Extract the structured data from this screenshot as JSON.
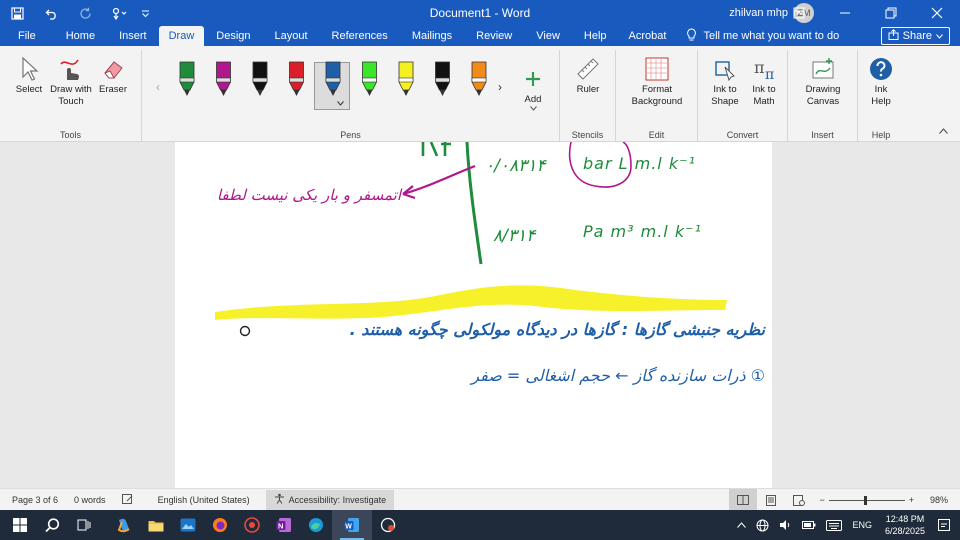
{
  "window": {
    "doc_title": "Document1 - Word",
    "user_name": "zhilvan mhp",
    "avatar_initials": "ZM"
  },
  "tabs": [
    {
      "label": "File"
    },
    {
      "label": "Home"
    },
    {
      "label": "Insert"
    },
    {
      "label": "Draw"
    },
    {
      "label": "Design"
    },
    {
      "label": "Layout"
    },
    {
      "label": "References"
    },
    {
      "label": "Mailings"
    },
    {
      "label": "Review"
    },
    {
      "label": "View"
    },
    {
      "label": "Help"
    },
    {
      "label": "Acrobat"
    }
  ],
  "active_tab": "Draw",
  "tell_me": "Tell me what you want to do",
  "share_label": "Share",
  "ribbon": {
    "tools": {
      "select": "Select",
      "draw_touch": "Draw with Touch",
      "eraser": "Eraser",
      "group": "Tools"
    },
    "pens": {
      "group": "Pens",
      "add": "Add",
      "colors": [
        "#1e8c3a",
        "#b0178c",
        "#111111",
        "#d9202a",
        "#1f5fa8",
        "#39e62a",
        "#f5f020",
        "#111111",
        "#f08a1a"
      ]
    },
    "stencils": {
      "ruler": "Ruler",
      "group": "Stencils"
    },
    "edit": {
      "format_bg": "Format Background",
      "group": "Edit"
    },
    "convert": {
      "ink_shape": "Ink to Shape",
      "ink_math": "Ink to Math",
      "group": "Convert"
    },
    "insert": {
      "drawing_canvas": "Drawing Canvas",
      "group": "Insert"
    },
    "help": {
      "ink_help": "Ink Help",
      "group": "Help"
    }
  },
  "status": {
    "page": "Page 3 of 6",
    "words": "0 words",
    "language": "English (United States)",
    "accessibility": "Accessibility: Investigate",
    "zoom": "98%",
    "zoom_fraction": 0.49
  },
  "taskbar": {
    "language": "ENG",
    "time": "12:48 PM",
    "date": "6/28/2025"
  },
  "ink": {
    "green_top": "۰/۰۸۳۱۴",
    "bar_unit": "bar L m.l k⁻¹",
    "green_bottom": "۸/۳۱۴",
    "pa_unit": "Pa m³ m.l k⁻¹",
    "purple_note": "اتمسفر و بار یکی نیست لطفا",
    "heading": "نظریه جنبشی گازها : گازها در دیدگاه مولکولی چگونه هستند .",
    "point_one": "① ذرات سازنده گاز ← حجم اشغالی = صفر"
  }
}
